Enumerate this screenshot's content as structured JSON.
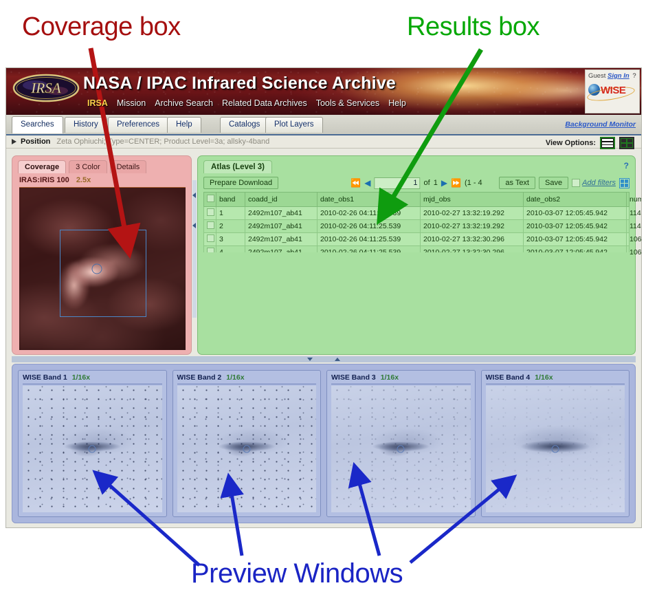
{
  "annotations": {
    "coverage": "Coverage box",
    "results": "Results box",
    "preview": "Preview Windows",
    "colors": {
      "coverage": "#a50f0f",
      "results": "#06a806",
      "preview": "#1a24c4"
    }
  },
  "banner": {
    "title": "NASA / IPAC Infrared Science Archive",
    "logo": "irsa-logo",
    "nav": [
      {
        "label": "IRSA",
        "active": true
      },
      {
        "label": "Mission",
        "active": false
      },
      {
        "label": "Archive Search",
        "active": false
      },
      {
        "label": "Related Data Archives",
        "active": false
      },
      {
        "label": "Tools & Services",
        "active": false
      },
      {
        "label": "Help",
        "active": false
      }
    ],
    "account": {
      "user": "Guest",
      "signin": "Sign In",
      "help": "?",
      "mission_logo": "WISE"
    }
  },
  "tabs": {
    "items": [
      {
        "label": "Searches",
        "selected": true
      },
      {
        "label": "History",
        "selected": false
      },
      {
        "label": "Preferences",
        "selected": false
      },
      {
        "label": "Help",
        "selected": false
      },
      {
        "label": "Catalogs",
        "selected": false
      },
      {
        "label": "Plot Layers",
        "selected": false
      }
    ],
    "background_monitor": "Background Monitor"
  },
  "position_bar": {
    "label": "Position",
    "details": "Zeta Ophiuchi; Type=CENTER; Product Level=3a; allsky-4band"
  },
  "view_options": {
    "label": "View Options:",
    "rows_icon": "rows-layout-icon",
    "grid_icon": "grid-layout-icon"
  },
  "coverage": {
    "tabs": [
      {
        "label": "Coverage",
        "selected": true
      },
      {
        "label": "3 Color",
        "selected": false
      },
      {
        "label": "Details",
        "selected": false
      }
    ],
    "survey": "IRAS:IRIS 100",
    "zoom": "2.5x"
  },
  "results": {
    "tab": "Atlas (Level 3)",
    "help": "?",
    "prepare_download": "Prepare Download",
    "as_text": "as Text",
    "save": "Save",
    "add_filters": "Add filters",
    "pager": {
      "page": "1",
      "of": "of",
      "total": "1",
      "range": "(1 - 4"
    },
    "columns": [
      "band",
      "coadd_id",
      "date_obs1",
      "mjd_obs",
      "date_obs2",
      "numfrms"
    ],
    "rows": [
      {
        "band": "1",
        "coadd_id": "2492m107_ab41",
        "date_obs1": "2010-02-26 04:11:25.539",
        "mjd_obs": "2010-02-27 13:32:19.292",
        "date_obs2": "2010-03-07 12:05:45.942",
        "numfrms": "114"
      },
      {
        "band": "2",
        "coadd_id": "2492m107_ab41",
        "date_obs1": "2010-02-26 04:11:25.539",
        "mjd_obs": "2010-02-27 13:32:19.292",
        "date_obs2": "2010-03-07 12:05:45.942",
        "numfrms": "114"
      },
      {
        "band": "3",
        "coadd_id": "2492m107_ab41",
        "date_obs1": "2010-02-26 04:11:25.539",
        "mjd_obs": "2010-02-27 13:32:30.296",
        "date_obs2": "2010-03-07 12:05:45.942",
        "numfrms": "106"
      },
      {
        "band": "4",
        "coadd_id": "2492m107_ab41",
        "date_obs1": "2010-02-26 04:11:25.539",
        "mjd_obs": "2010-02-27 13:32:30.296",
        "date_obs2": "2010-03-07 12:05:45.942",
        "numfrms": "106"
      }
    ]
  },
  "previews": [
    {
      "title": "WISE Band 1",
      "zoom": "1/16x"
    },
    {
      "title": "WISE Band 2",
      "zoom": "1/16x"
    },
    {
      "title": "WISE Band 3",
      "zoom": "1/16x"
    },
    {
      "title": "WISE Band 4",
      "zoom": "1/16x"
    }
  ]
}
